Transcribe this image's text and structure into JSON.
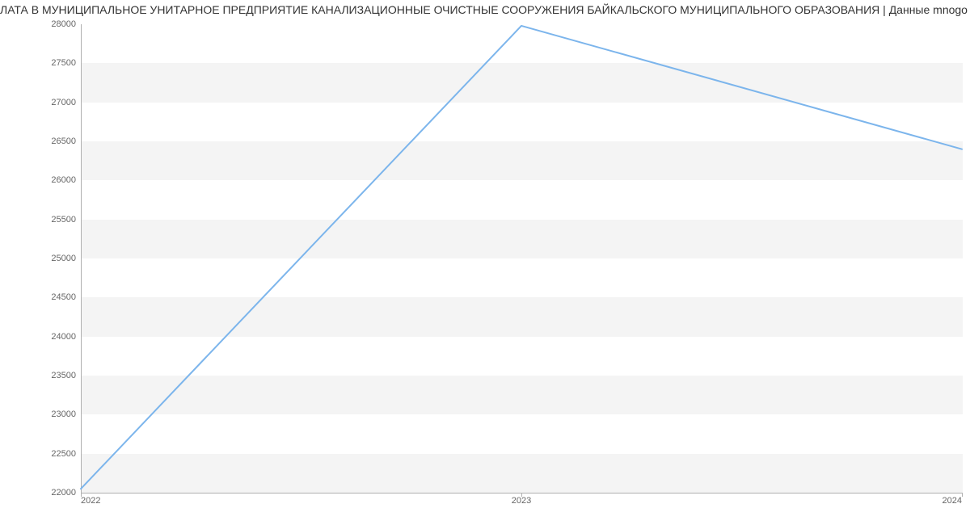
{
  "chart_data": {
    "type": "line",
    "title": "ЛАТА В МУНИЦИПАЛЬНОЕ УНИТАРНОЕ ПРЕДПРИЯТИЕ КАНАЛИЗАЦИОННЫЕ ОЧИСТНЫЕ СООРУЖЕНИЯ БАЙКАЛЬСКОГО МУНИЦИПАЛЬНОГО ОБРАЗОВАНИЯ | Данные mnogo",
    "x": [
      2022,
      2023,
      2024
    ],
    "values": [
      22050,
      27980,
      26400
    ],
    "xlabel": "",
    "ylabel": "",
    "xlim": [
      2022,
      2024
    ],
    "ylim": [
      22000,
      28000
    ],
    "x_ticks": [
      2022,
      2023,
      2024
    ],
    "y_ticks": [
      22000,
      22500,
      23000,
      23500,
      24000,
      24500,
      25000,
      25500,
      26000,
      26500,
      27000,
      27500,
      28000
    ],
    "line_color": "#7cb5ec"
  }
}
